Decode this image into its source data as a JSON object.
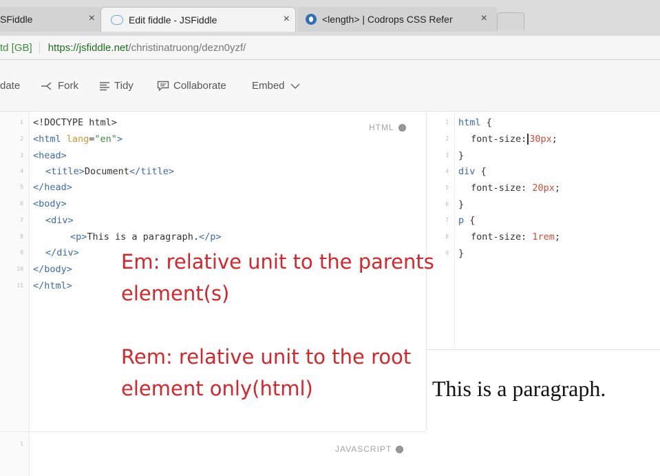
{
  "browser": {
    "tabs": [
      {
        "label": "SFiddle",
        "close": "×"
      },
      {
        "label": "Edit fiddle - JSFiddle",
        "close": "×"
      },
      {
        "label": "<length> | Codrops CSS Refer",
        "close": "×"
      }
    ],
    "address": {
      "cert": "td [GB]",
      "host": "https://jsfiddle.net",
      "path": "/christinatruong/dezn0yzf/"
    }
  },
  "toolbar": {
    "update": "date",
    "fork": "Fork",
    "tidy": "Tidy",
    "collaborate": "Collaborate",
    "embed": "Embed"
  },
  "html_panel": {
    "label": "HTML",
    "line_numbers": [
      "1",
      "2",
      "3",
      "4",
      "5",
      "6",
      "7",
      "8",
      "9",
      "10",
      "11"
    ],
    "lines": {
      "l1": "<!DOCTYPE html>",
      "l2_open": "<html",
      "l2_attr": " lang",
      "l2_eq": "=",
      "l2_val": "\"en\"",
      "l2_close": ">",
      "l3": "<head>",
      "l4_open": "<title>",
      "l4_text": "Document",
      "l4_close": "</title>",
      "l5": "</head>",
      "l6": "<body>",
      "l7": "<div>",
      "l8_open": "<p>",
      "l8_text": "This is a paragraph.",
      "l8_close": "</p>",
      "l9": "</div>",
      "l10": "</body>",
      "l11": "</html>"
    }
  },
  "css_panel": {
    "line_numbers": [
      "1",
      "2",
      "3",
      "4",
      "5",
      "6",
      "7",
      "8",
      "9"
    ],
    "lines": {
      "l1_sel": "html",
      "l1_brace": " {",
      "l2_prop": "font-size:",
      "l2_val": "30px",
      "l2_semi": ";",
      "l3": "}",
      "l4_sel": "div",
      "l4_brace": " {",
      "l5_prop": "font-size: ",
      "l5_val": "20px",
      "l5_semi": ";",
      "l6": "}",
      "l7_sel": "p",
      "l7_brace": " {",
      "l8_prop": "font-size: ",
      "l8_val": "1rem",
      "l8_semi": ";",
      "l9": "}"
    }
  },
  "js_panel": {
    "label": "JAVASCRIPT",
    "line_number": "1"
  },
  "result": {
    "text": "This is a paragraph."
  },
  "annotation": {
    "em_line1": "Em: relative unit to the parents",
    "em_line2": "element(s)",
    "rem_line1": "Rem: relative unit to the root",
    "rem_line2": "element only(html)",
    "color": "#d6262b"
  }
}
